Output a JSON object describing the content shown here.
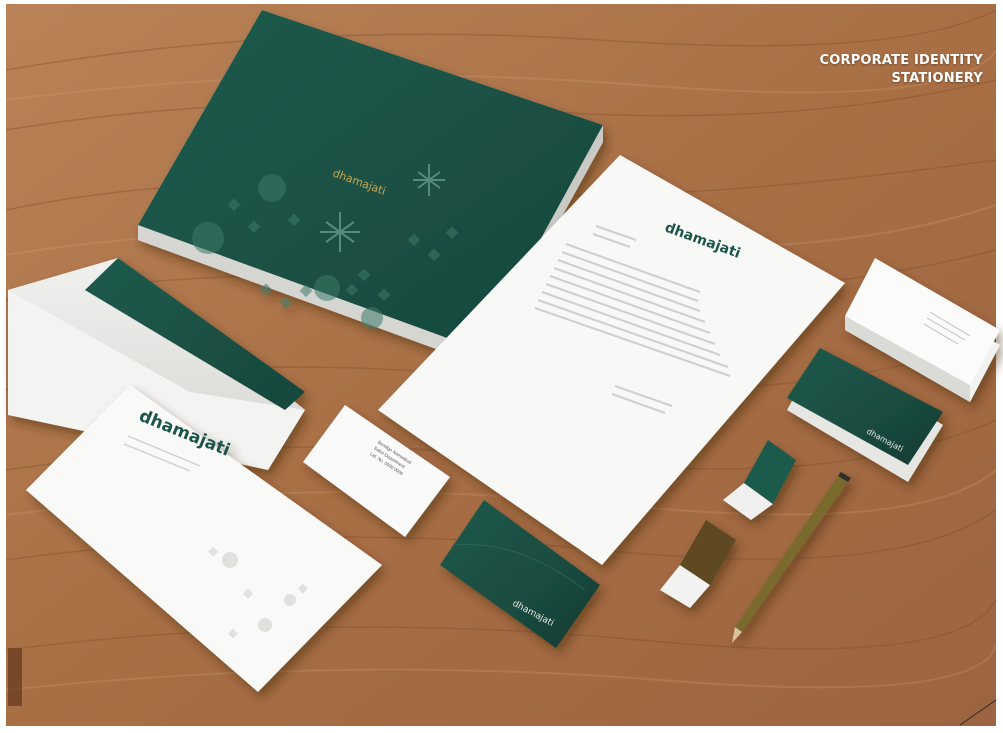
{
  "caption": {
    "line1": "CORPORATE IDENTITY",
    "line2": "STATIONERY"
  },
  "brand": {
    "name": "dhamajati"
  },
  "colors": {
    "primary_green": "#1d5548",
    "gold": "#b49a4c",
    "wood": "#a9714a",
    "paper": "#f6f6f4"
  },
  "card_back": {
    "line1": "Bendigo Nomadical",
    "line2": "Sales Department",
    "line3": "Ltd. No. 0000 0000"
  }
}
